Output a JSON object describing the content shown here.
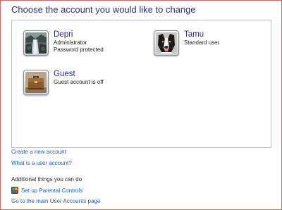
{
  "heading": "Choose the account you would like to change",
  "accounts": [
    {
      "name": "Depri",
      "details": [
        "Administrator",
        "Password protected"
      ],
      "picture": "waterfall-picture"
    },
    {
      "name": "Tamu",
      "details": [
        "Standard user"
      ],
      "picture": "dog-picture"
    },
    {
      "name": "Guest",
      "details": [
        "Guest account is off"
      ],
      "picture": "briefcase-picture"
    }
  ],
  "links": {
    "create": "Create a new account",
    "whatis": "What is a user account?"
  },
  "additional": {
    "heading": "Additional things you can do",
    "parental": "Set up Parental Controls",
    "parental_icon": "shield-icon",
    "main": "Go to the main User Accounts page"
  },
  "colors": {
    "heading": "#1e3287",
    "link": "#1a5bc4",
    "panel_border": "#b8bec8"
  }
}
